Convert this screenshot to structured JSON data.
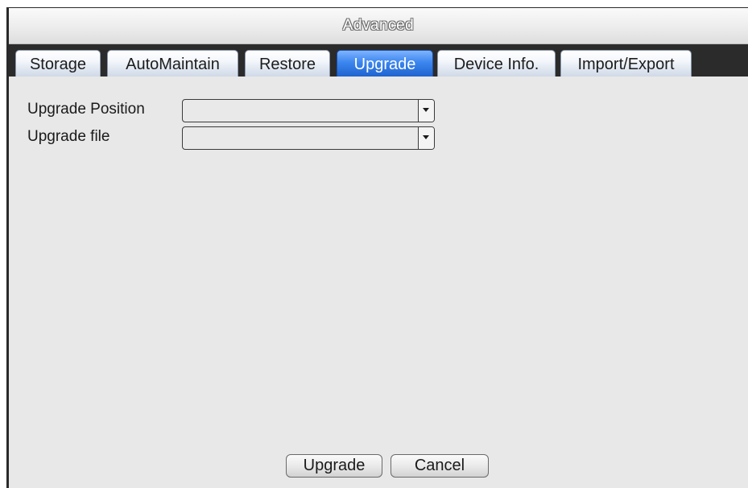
{
  "window": {
    "title": "Advanced"
  },
  "tabs": [
    {
      "label": "Storage",
      "active": false
    },
    {
      "label": "AutoMaintain",
      "active": false
    },
    {
      "label": "Restore",
      "active": false
    },
    {
      "label": "Upgrade",
      "active": true
    },
    {
      "label": "Device Info.",
      "active": false
    },
    {
      "label": "Import/Export",
      "active": false
    }
  ],
  "form": {
    "upgrade_position": {
      "label": "Upgrade Position",
      "value": ""
    },
    "upgrade_file": {
      "label": "Upgrade file",
      "value": ""
    }
  },
  "buttons": {
    "upgrade": "Upgrade",
    "cancel": "Cancel"
  },
  "colors": {
    "active_tab": "#3c86ef",
    "tab_bar": "#2b2b2b",
    "panel": "#e8e8e8"
  },
  "icons": {
    "dropdown": "chevron-down-icon"
  }
}
